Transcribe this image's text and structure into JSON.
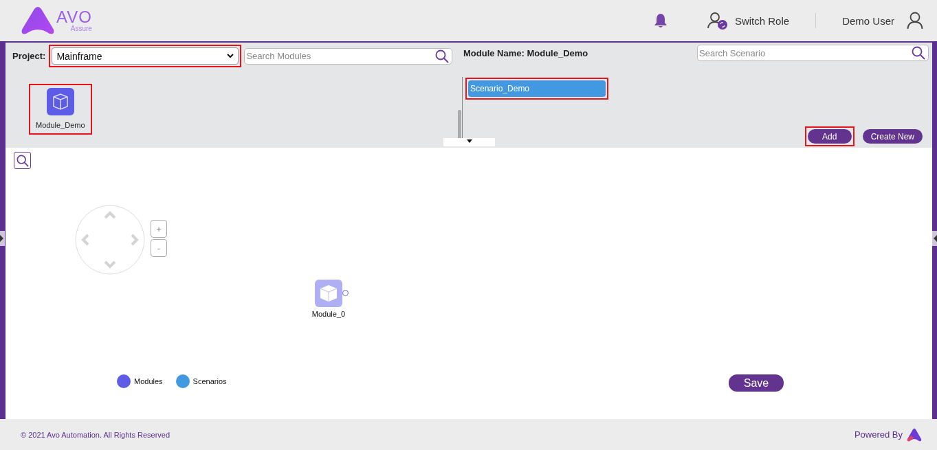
{
  "header": {
    "logo_text": "AVO",
    "logo_subtext": "Assure",
    "switch_role": "Switch Role",
    "user_name": "Demo User"
  },
  "modules_panel": {
    "project_label": "Project:",
    "project": {
      "value": "Mainframe",
      "highlighted": true
    },
    "search": {
      "placeholder": "Search Modules"
    },
    "modules": [
      {
        "name": "Module_Demo",
        "highlighted": true
      }
    ]
  },
  "scenarios_panel": {
    "module_name_label": "Module Name: Module_Demo",
    "search": {
      "placeholder": "Search Scenario"
    },
    "scenarios": [
      {
        "name": "Scenario_Demo",
        "selected": true,
        "highlighted": true
      }
    ],
    "buttons": [
      {
        "label": "Add",
        "highlighted": true
      },
      {
        "label": "Create New",
        "highlighted": false
      }
    ]
  },
  "canvas": {
    "zoom_in": "+",
    "zoom_out": "-",
    "nodes": [
      {
        "name": "Module_0",
        "kind": "module"
      }
    ],
    "legend": [
      {
        "label": "Modules",
        "color": "#5d5ce6"
      },
      {
        "label": "Scenarios",
        "color": "#4399e1"
      }
    ],
    "save": "Save"
  },
  "footer": {
    "copyright": "© 2021 Avo Automation. All Rights Reserved",
    "powered_by": "Powered By"
  }
}
